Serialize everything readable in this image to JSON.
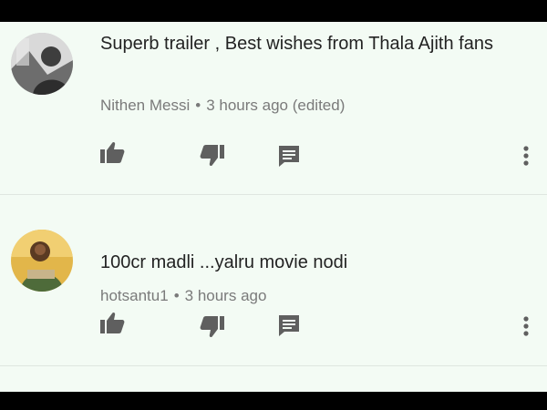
{
  "comments": [
    {
      "text": "Superb trailer , Best wishes from Thala Ajith fans",
      "author": "Nithen Messi",
      "separator": "•",
      "time": "3 hours ago (edited)",
      "avatar_icon": "grayscale-profile-photo"
    },
    {
      "text": "100cr madli ...yalru movie nodi",
      "author": "hotsantu1",
      "separator": "•",
      "time": "3 hours ago",
      "avatar_icon": "color-profile-photo"
    }
  ],
  "actions": {
    "like_icon": "thumbs-up-icon",
    "dislike_icon": "thumbs-down-icon",
    "reply_icon": "comment-icon",
    "menu_icon": "more-vert-icon"
  },
  "colors": {
    "background": "#f3fbf4",
    "text": "#232323",
    "meta": "#7a7a7a",
    "icon": "#5f5f5f"
  }
}
